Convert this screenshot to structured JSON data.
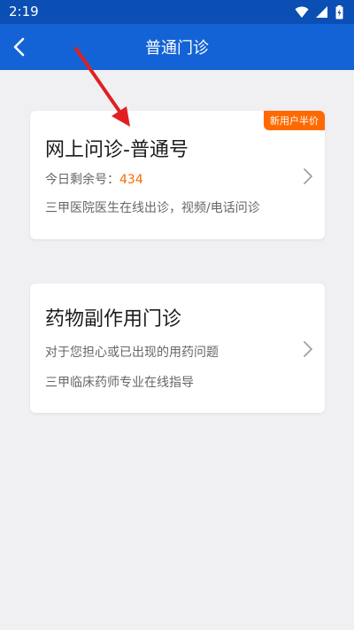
{
  "status": {
    "time": "2:19",
    "icons": [
      "wifi-icon",
      "signal-icon",
      "battery-icon"
    ]
  },
  "header": {
    "back_icon": "back-arrow-icon",
    "title": "普通门诊"
  },
  "cards": [
    {
      "badge": "新用户半价",
      "title": "网上问诊-普通号",
      "line1_prefix": "今日剩余号：",
      "line1_value": "434",
      "line2": "三甲医院医生在线出诊，视频/电话问诊"
    },
    {
      "title": "药物副作用门诊",
      "line1": "对于您担心或已出现的用药问题",
      "line2": "三甲临床药师专业在线指导"
    }
  ],
  "colors": {
    "header": "#1363d6",
    "statusbar": "#0b4fb4",
    "accent": "#ff6a00",
    "annotation": "#e02020"
  }
}
